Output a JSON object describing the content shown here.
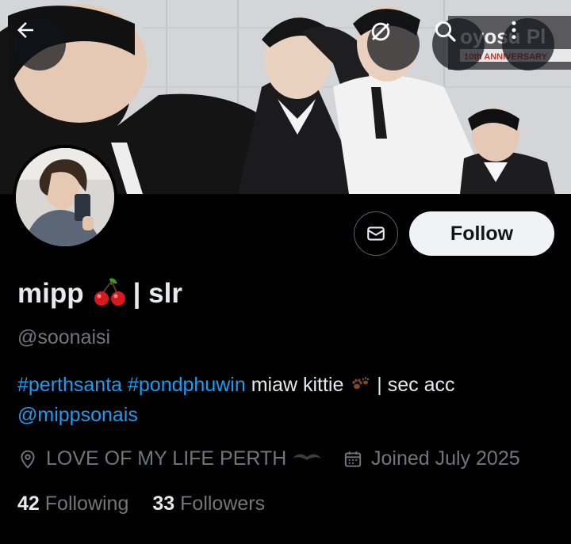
{
  "profile": {
    "display_name": "mipp",
    "display_suffix": "| slr",
    "handle": "@soonaisi",
    "bio": {
      "tag1": "#perthsanta",
      "tag2": "#pondphuwin",
      "text1": "miaw kittie",
      "text2": "| sec acc",
      "mention": "@mippsonais"
    },
    "location": "LOVE OF MY LIFE PERTH",
    "joined": "Joined July 2025",
    "following_count": "42",
    "following_label": "Following",
    "followers_count": "33",
    "followers_label": "Followers"
  },
  "actions": {
    "follow_label": "Follow"
  },
  "banner": {
    "sign_text": "oyosu Pl",
    "sign_sub": "10th ANNIVERSARY"
  },
  "icons": {
    "back": "arrow-left-icon",
    "swap": "swap-icon",
    "search": "search-icon",
    "more": "more-vertical-icon",
    "message": "envelope-icon",
    "location": "location-pin-icon",
    "calendar": "calendar-icon",
    "cherry": "cherry-emoji",
    "paw": "paw-emoji",
    "heart": "black-heart-emoji"
  },
  "colors": {
    "background": "#000000",
    "link": "#1d9bf0",
    "muted": "#71767b",
    "text": "#e7e9ea",
    "follow_bg": "#eff3f4"
  }
}
